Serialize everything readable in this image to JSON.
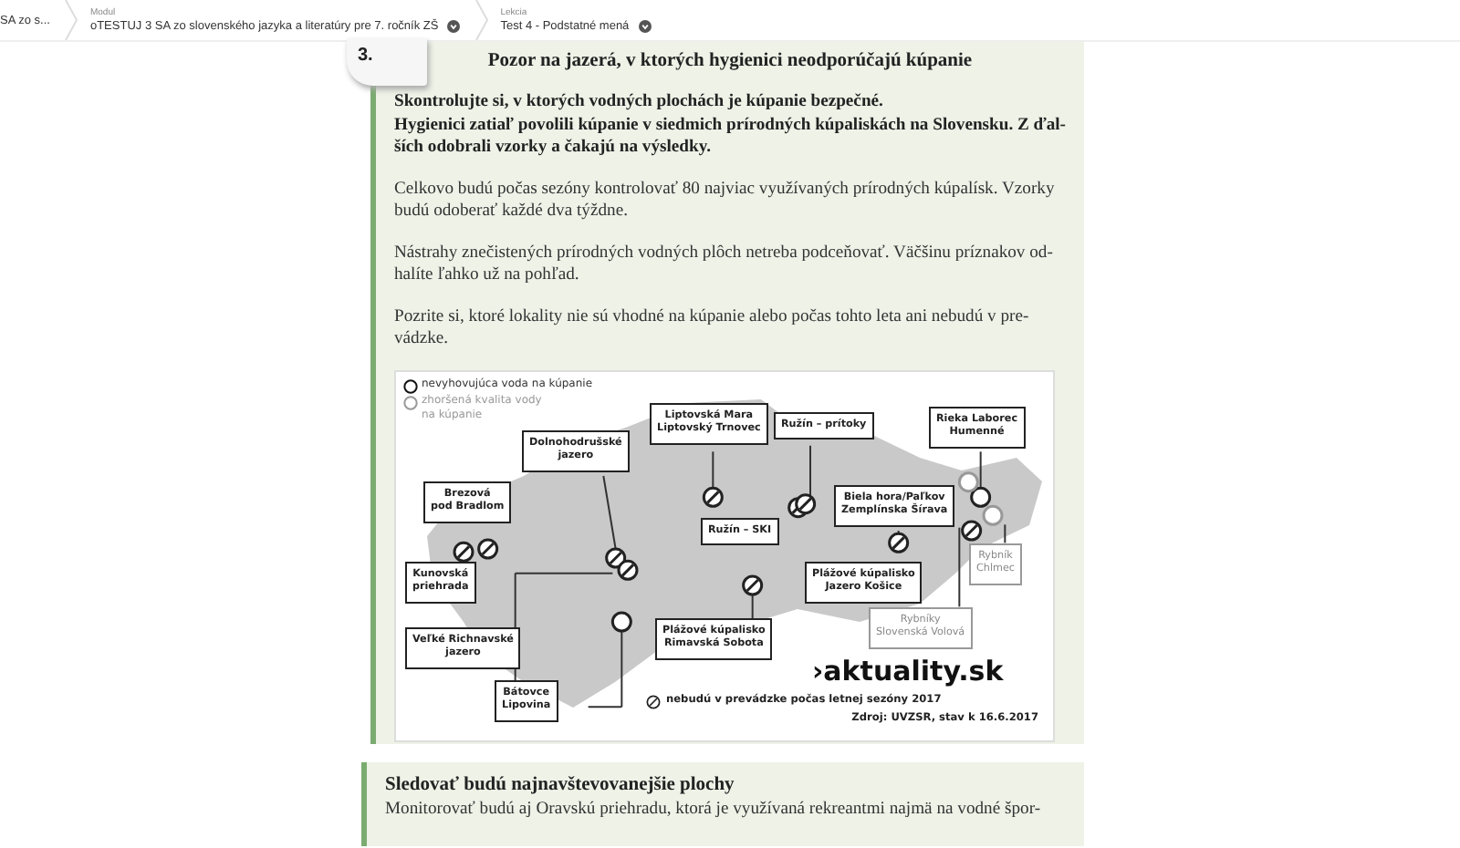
{
  "breadcrumb": [
    {
      "value": "SA zo s..."
    },
    {
      "label": "Modul",
      "value": "oTESTUJ 3 SA zo slovenského jazyka a literatúry pre 7. ročník ZŠ"
    },
    {
      "label": "Lekcia",
      "value": "Test 4 - Podstatné mená"
    }
  ],
  "article": {
    "number": "3.",
    "title": "Pozor na jazerá, v ktorých hygienici neodporúčajú kúpanie",
    "paragraphs": [
      {
        "bold": true,
        "lines": [
          "Skontrolujte si, v ktorých vodných plochách je kúpanie bezpečné.",
          "Hygienici zatiaľ povolili kúpanie v siedmich prírodných kúpaliskách na Slovensku. Z ďal-",
          "ších odobrali vzorky a čakajú na výsledky."
        ]
      },
      {
        "bold": false,
        "lines": [
          "Celkovo budú počas sezóny kontrolovať 80 najviac využívaných prírodných kúpalísk. Vzorky",
          "budú odoberať každé dva týždne."
        ]
      },
      {
        "bold": false,
        "lines": [
          "Nástrahy znečistených prírodných vodných plôch netreba podceňovať. Väčšinu príznakov od-",
          "halíte ľahko už na pohľad."
        ]
      },
      {
        "bold": false,
        "lines": [
          "Pozrite si, ktoré lokality nie sú vhodné na kúpanie alebo počas tohto leta ani nebudú v pre-",
          "vádzke."
        ]
      }
    ]
  },
  "map": {
    "legend": [
      {
        "kind": "bad",
        "text": "nevyhovujúca voda na kúpanie"
      },
      {
        "kind": "worse",
        "text": "zhoršená kvalita vody na kúpanie"
      }
    ],
    "labels": [
      {
        "kind": "dark",
        "lines": [
          "Liptovská Mara",
          "Liptovský Trnovec"
        ]
      },
      {
        "kind": "dark",
        "lines": [
          "Ružín – prítoky"
        ]
      },
      {
        "kind": "dark",
        "lines": [
          "Rieka Laborec",
          "Humenné"
        ]
      },
      {
        "kind": "dark",
        "lines": [
          "Dolnohodrušské",
          "jazero"
        ]
      },
      {
        "kind": "dark",
        "lines": [
          "Brezová",
          "pod Bradlom"
        ]
      },
      {
        "kind": "dark",
        "lines": [
          "Biela hora/Paľkov",
          "Zemplínska Šírava"
        ]
      },
      {
        "kind": "dark",
        "lines": [
          "Ružín – SKI"
        ]
      },
      {
        "kind": "dark",
        "lines": [
          "Kunovská",
          "priehrada"
        ]
      },
      {
        "kind": "dark",
        "lines": [
          "Plážové kúpalisko",
          "Jazero Košice"
        ]
      },
      {
        "kind": "grey",
        "lines": [
          "Rybník",
          "Chlmec"
        ]
      },
      {
        "kind": "grey",
        "lines": [
          "Rybníky",
          "Slovenská Volová"
        ]
      },
      {
        "kind": "dark",
        "lines": [
          "Veľké Richnavské",
          "jazero"
        ]
      },
      {
        "kind": "dark",
        "lines": [
          "Plážové kúpalisko",
          "Rimavská Sobota"
        ]
      },
      {
        "kind": "dark",
        "lines": [
          "Bátovce",
          "Lipovina"
        ]
      }
    ],
    "brand": "›aktuality.sk",
    "closed_legend": "nebudú v prevádzke počas letnej sezóny 2017",
    "source": "Zdroj: UVZSR, stav k 16.6.2017"
  },
  "section": {
    "title": "Sledovať budú najnavštevovanejšie plochy",
    "text": "Monitorovať budú aj Oravskú priehradu, ktorá je využívaná rekreantmi najmä na vodné špor-"
  }
}
